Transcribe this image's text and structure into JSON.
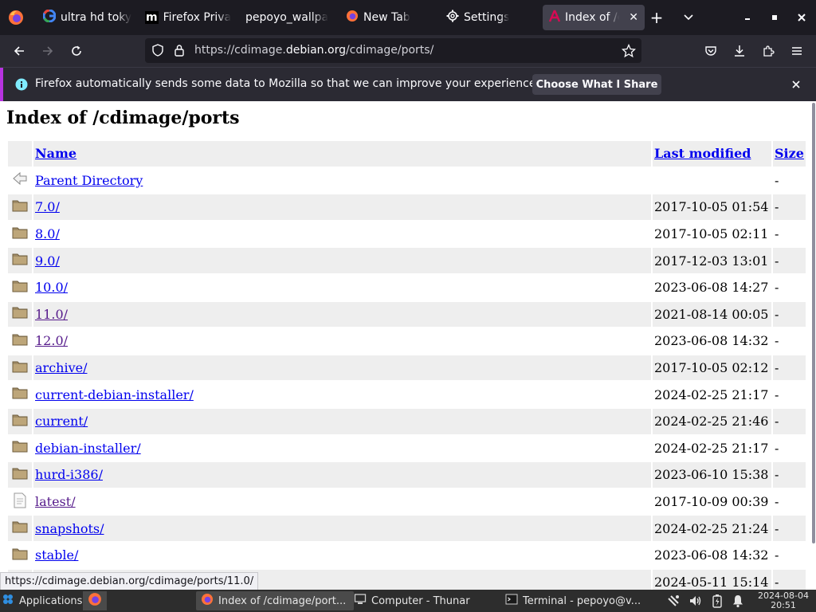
{
  "tabs": [
    {
      "label": "ultra hd toky",
      "icon": "google-g-icon",
      "active": false
    },
    {
      "label": "Firefox Priva",
      "icon": "m-logo-icon",
      "active": false
    },
    {
      "label": "pepoyo_wallpa",
      "icon": "none",
      "active": false
    },
    {
      "label": "New Tab",
      "icon": "firefox-icon",
      "active": false
    },
    {
      "label": "Settings",
      "icon": "gear-icon",
      "active": false
    },
    {
      "label": "Index of /c",
      "icon": "debian-icon",
      "active": true
    }
  ],
  "address_bar": {
    "url_prefix": "https://cdimage.",
    "url_host": "debian.org",
    "url_suffix": "/cdimage/ports/"
  },
  "notification": {
    "text": "Firefox automatically sends some data to Mozilla so that we can improve your experience.",
    "button_label": "Choose What I Share"
  },
  "page": {
    "title": "Index of /cdimage/ports",
    "columns": {
      "name": "Name",
      "last_modified": "Last modified",
      "size": "Size"
    },
    "rows": [
      {
        "icon": "back-arrow-icon",
        "name": "Parent Directory",
        "modified": "",
        "size": "-"
      },
      {
        "icon": "folder-icon",
        "name": "7.0/",
        "modified": "2017-10-05 01:54",
        "size": "-"
      },
      {
        "icon": "folder-icon",
        "name": "8.0/",
        "modified": "2017-10-05 02:11",
        "size": "-"
      },
      {
        "icon": "folder-icon",
        "name": "9.0/",
        "modified": "2017-12-03 13:01",
        "size": "-"
      },
      {
        "icon": "folder-icon",
        "name": "10.0/",
        "modified": "2023-06-08 14:27",
        "size": "-"
      },
      {
        "icon": "folder-icon",
        "name": "11.0/",
        "modified": "2021-08-14 00:05",
        "size": "-"
      },
      {
        "icon": "folder-icon",
        "name": "12.0/",
        "modified": "2023-06-08 14:32",
        "size": "-"
      },
      {
        "icon": "folder-icon",
        "name": "archive/",
        "modified": "2017-10-05 02:12",
        "size": "-"
      },
      {
        "icon": "folder-icon",
        "name": "current-debian-installer/",
        "modified": "2024-02-25 21:17",
        "size": "-"
      },
      {
        "icon": "folder-icon",
        "name": "current/",
        "modified": "2024-02-25 21:46",
        "size": "-"
      },
      {
        "icon": "folder-icon",
        "name": "debian-installer/",
        "modified": "2024-02-25 21:17",
        "size": "-"
      },
      {
        "icon": "folder-icon",
        "name": "hurd-i386/",
        "modified": "2023-06-10 15:38",
        "size": "-"
      },
      {
        "icon": "file-icon",
        "name": "latest/",
        "modified": "2017-10-09 00:39",
        "size": "-"
      },
      {
        "icon": "folder-icon",
        "name": "snapshots/",
        "modified": "2024-02-25 21:24",
        "size": "-"
      },
      {
        "icon": "folder-icon",
        "name": "stable/",
        "modified": "2023-06-08 14:32",
        "size": "-"
      },
      {
        "icon": "folder-icon",
        "name": "",
        "modified": "2024-05-11 15:14",
        "size": "-"
      }
    ]
  },
  "status_tooltip": "https://cdimage.debian.org/cdimage/ports/11.0/",
  "taskbar": {
    "apps_label": "Applications",
    "tasks": [
      {
        "label": "Index of /cdimage/port...",
        "icon": "firefox-icon",
        "active": true
      },
      {
        "label": "Computer - Thunar",
        "icon": "computer-icon",
        "active": false
      },
      {
        "label": "Terminal - pepoyo@v...",
        "icon": "terminal-icon",
        "active": false
      }
    ],
    "clock_date": "2024-08-04",
    "clock_time": "20:51"
  }
}
